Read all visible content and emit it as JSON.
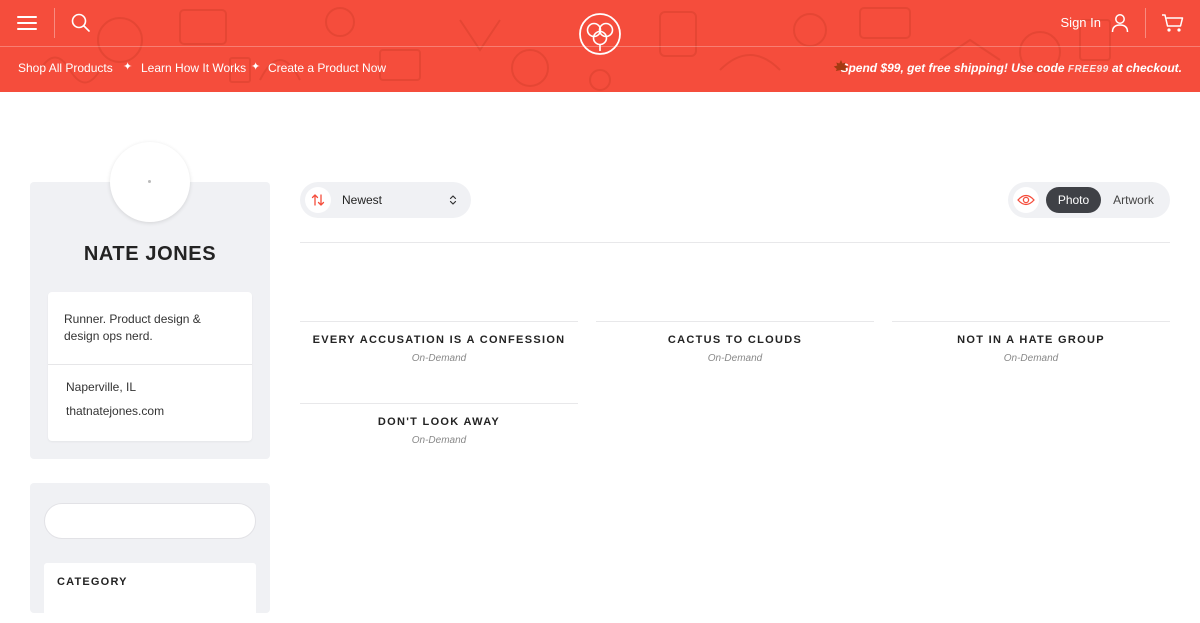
{
  "header": {
    "brand_color": "#f54d3c",
    "menu_icon": "hamburger-menu-icon",
    "search_icon": "search-icon",
    "logo_icon": "cotton-flower-logo-icon",
    "signin_label": "Sign In",
    "user_icon": "user-icon",
    "cart_icon": "cart-icon",
    "nav": {
      "shop_all": "Shop All Products",
      "learn": "Learn How It Works",
      "create": "Create a Product Now",
      "separator": "✦"
    },
    "promo": {
      "leaf_icon": "maple-leaf-icon",
      "text_before": "Spend $99, get free shipping! Use code ",
      "code": "FREE99",
      "text_after": " at checkout."
    }
  },
  "profile": {
    "name": "NATE JONES",
    "bio": "Runner. Product design & design ops nerd.",
    "location": "Naperville, IL",
    "website": "thatnatejones.com"
  },
  "filters": {
    "search_value": "",
    "category_title": "CATEGORY"
  },
  "toolbar": {
    "sort_icon": "sort-arrows-icon",
    "sort_value": "Newest",
    "view_icon": "eye-icon",
    "view_options": [
      "Photo",
      "Artwork"
    ],
    "view_selected": "Photo"
  },
  "products": [
    {
      "title": "EVERY ACCUSATION IS A CONFESSION",
      "type": "On-Demand"
    },
    {
      "title": "CACTUS TO CLOUDS",
      "type": "On-Demand"
    },
    {
      "title": "NOT IN A HATE GROUP",
      "type": "On-Demand"
    },
    {
      "title": "DON'T LOOK AWAY",
      "type": "On-Demand"
    }
  ]
}
